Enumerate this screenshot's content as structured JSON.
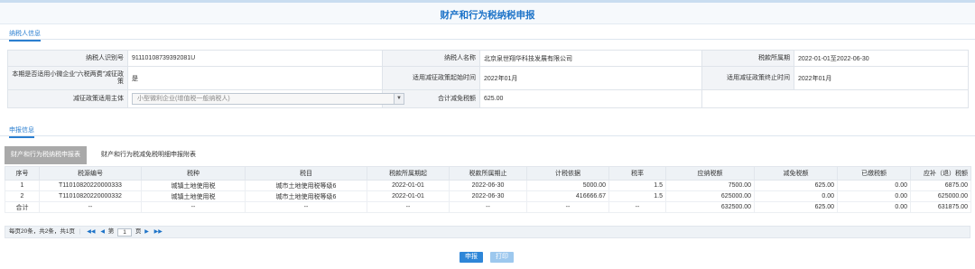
{
  "page": {
    "title": "财产和行为税纳税申报"
  },
  "section_taxpayer": {
    "tab_label": "纳税人信息"
  },
  "taxpayer": {
    "id_label": "纳税人识别号",
    "id_value": "91110108739392081U",
    "name_label": "纳税人名称",
    "name_value": "北京泉世翔华科技发展有限公司",
    "period_label": "税款所属期",
    "period_value": "2022-01-01至2022-06-30",
    "small_label": "本期是否适用小微企业“六税两费”减征政策",
    "small_value": "是",
    "policy_start_label": "适用减征政策起始时间",
    "policy_start_value": "2022年01月",
    "policy_end_label": "适用减征政策终止时间",
    "policy_end_value": "2022年01月",
    "subject_label": "减征政策适用主体",
    "subject_value": "小型微利企业(增值税一般纳税人)",
    "reduction_label": "合计减免税额",
    "reduction_value": "625.00"
  },
  "section_declare": {
    "tab_label": "申报信息"
  },
  "subtabs": {
    "active": "财产和行为税纳税申报表",
    "inactive": "财产和行为税减免税明细申报附表"
  },
  "grid": {
    "headers": [
      "序号",
      "税源编号",
      "税种",
      "税目",
      "税款所属期起",
      "税款所属期止",
      "计税依据",
      "税率",
      "应纳税额",
      "减免税额",
      "已缴税额",
      "应补（退）税额"
    ],
    "rows": [
      [
        "1",
        "T11010820220000333",
        "城镇土地使用税",
        "城市土地使用税等级6",
        "2022-01-01",
        "2022-06-30",
        "5000.00",
        "1.5",
        "7500.00",
        "625.00",
        "0.00",
        "6875.00"
      ],
      [
        "2",
        "T11010820220000332",
        "城镇土地使用税",
        "城市土地使用税等级6",
        "2022-01-01",
        "2022-06-30",
        "416666.67",
        "1.5",
        "625000.00",
        "0.00",
        "0.00",
        "625000.00"
      ],
      [
        "合计",
        "--",
        "--",
        "--",
        "--",
        "--",
        "--",
        "--",
        "632500.00",
        "625.00",
        "0.00",
        "631875.00"
      ]
    ]
  },
  "pager": {
    "summary": "每页20条，共2条，共1页",
    "first": "◀◀",
    "prev": "◀",
    "page_prefix": "第",
    "page_value": "1",
    "page_suffix": "页",
    "next": "▶",
    "last": "▶▶"
  },
  "actions": {
    "submit": "申报",
    "print": "打印"
  }
}
